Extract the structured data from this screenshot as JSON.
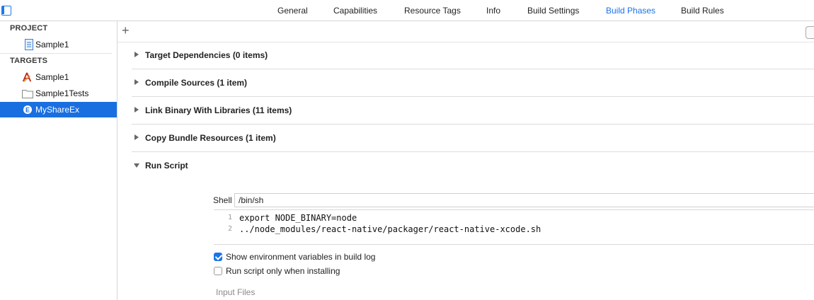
{
  "tabs": [
    {
      "label": "General",
      "active": false
    },
    {
      "label": "Capabilities",
      "active": false
    },
    {
      "label": "Resource Tags",
      "active": false
    },
    {
      "label": "Info",
      "active": false
    },
    {
      "label": "Build Settings",
      "active": false
    },
    {
      "label": "Build Phases",
      "active": true
    },
    {
      "label": "Build Rules",
      "active": false
    }
  ],
  "sidebar": {
    "project_header": "PROJECT",
    "project_items": [
      {
        "label": "Sample1",
        "icon": "project-file-icon"
      }
    ],
    "targets_header": "TARGETS",
    "target_items": [
      {
        "label": "Sample1",
        "icon": "app-target-icon",
        "selected": false
      },
      {
        "label": "Sample1Tests",
        "icon": "folder-icon",
        "selected": false
      },
      {
        "label": "MyShareEx",
        "icon": "extension-icon",
        "selected": true
      }
    ]
  },
  "toolbar": {
    "add_symbol": "+",
    "filter_icon": "filter-icon"
  },
  "phases": [
    {
      "title": "Target Dependencies (0 items)",
      "expanded": false
    },
    {
      "title": "Compile Sources (1 item)",
      "expanded": false
    },
    {
      "title": "Link Binary With Libraries (11 items)",
      "expanded": false
    },
    {
      "title": "Copy Bundle Resources (1 item)",
      "expanded": false
    },
    {
      "title": "Run Script",
      "expanded": true
    }
  ],
  "run_script": {
    "shell_label": "Shell",
    "shell_value": "/bin/sh",
    "lines": [
      {
        "num": "1",
        "text": "export NODE_BINARY=node"
      },
      {
        "num": "2",
        "text": "../node_modules/react-native/packager/react-native-xcode.sh"
      }
    ],
    "options": [
      {
        "label": "Show environment variables in build log",
        "checked": true
      },
      {
        "label": "Run script only when installing",
        "checked": false
      }
    ],
    "input_files_label": "Input Files"
  },
  "colors": {
    "accent": "#1a73e8",
    "selection": "#1a6fe0"
  }
}
